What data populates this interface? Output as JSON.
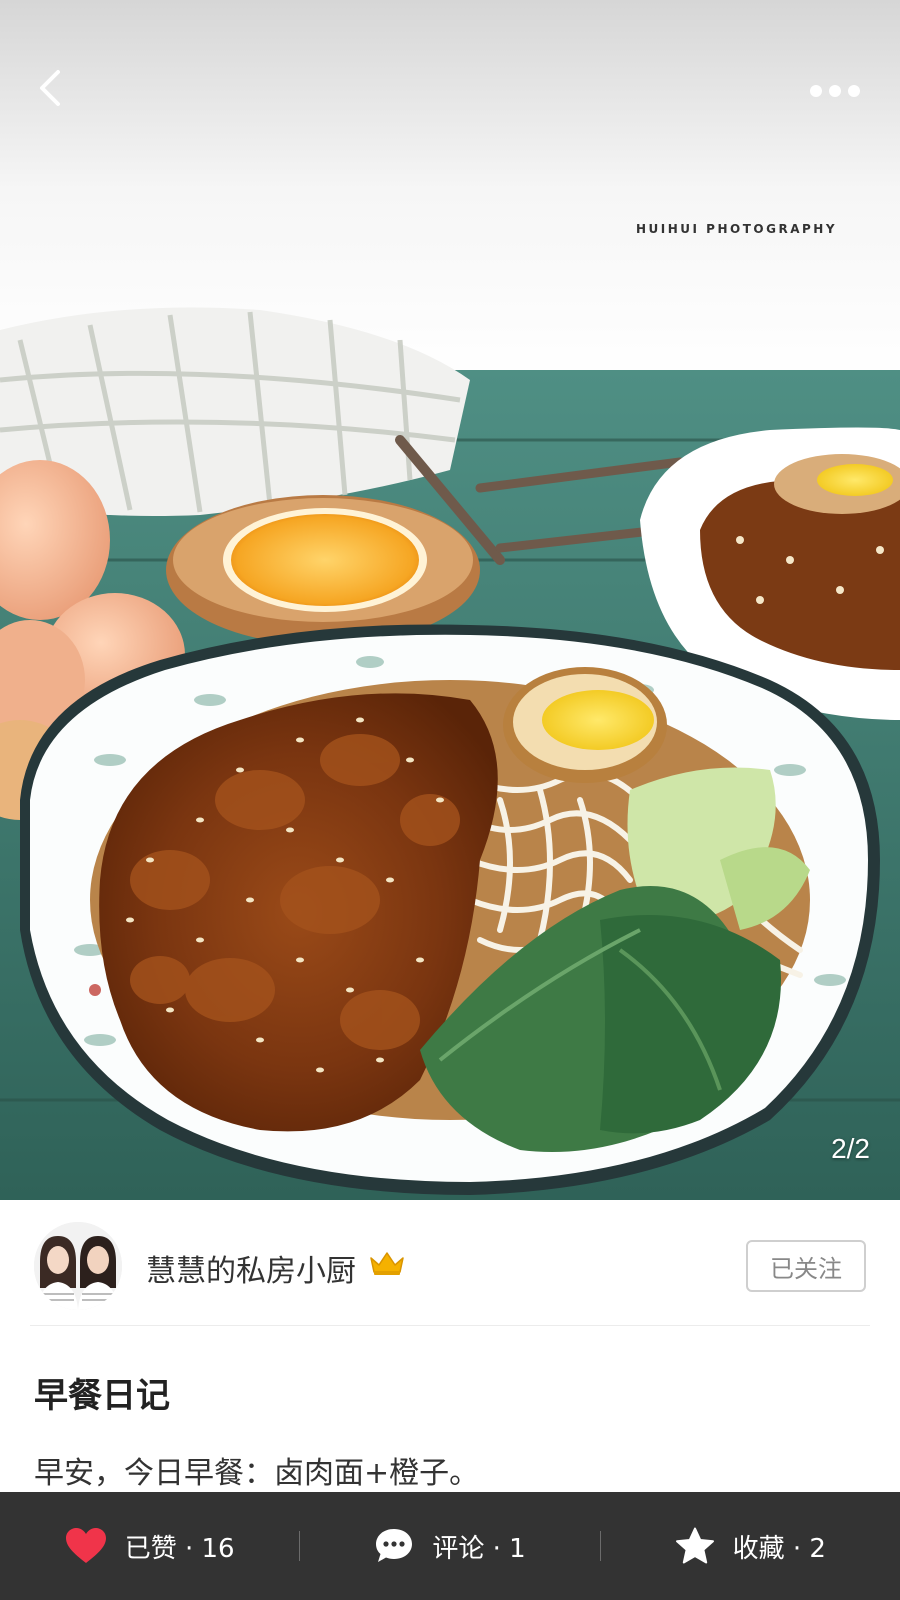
{
  "nav": {
    "back_icon": "chevron-left-icon",
    "more_icon": "more-horizontal-icon"
  },
  "photo": {
    "watermark": "HUIHUI PHOTOGRAPHY",
    "page_indicator": "2/2"
  },
  "author": {
    "name": "慧慧的私房小厨",
    "badge_icon": "crown-icon",
    "follow_label": "已关注"
  },
  "post": {
    "title": "早餐日记",
    "body": "早安，今日早餐：卤肉面+橙子。"
  },
  "actions": {
    "like": {
      "label": "已赞 · 16",
      "icon": "heart-icon",
      "color": "#f0344a"
    },
    "comment": {
      "label": "评论 · 1",
      "icon": "chat-bubble-icon"
    },
    "favorite": {
      "label": "收藏 · 2",
      "icon": "star-icon"
    }
  },
  "colors": {
    "bottom_bar": "#333333",
    "like_red": "#f0344a",
    "crown_gold": "#f5b100"
  }
}
